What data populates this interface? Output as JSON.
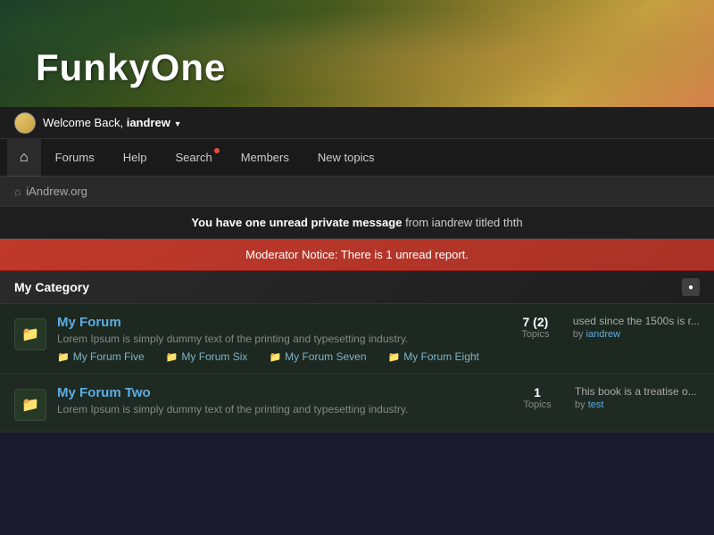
{
  "site": {
    "title": "FunkyOne"
  },
  "userbar": {
    "welcome_text": "Welcome Back,",
    "username": "iandrew",
    "dropdown_char": "▾"
  },
  "nav": {
    "home_icon": "⌂",
    "items": [
      {
        "label": "Forums",
        "id": "forums",
        "active": false
      },
      {
        "label": "Help",
        "id": "help",
        "active": false
      },
      {
        "label": "Search",
        "id": "search",
        "active": false,
        "has_dot": true
      },
      {
        "label": "Members",
        "id": "members",
        "active": false
      },
      {
        "label": "New topics",
        "id": "new-topics",
        "active": false
      }
    ]
  },
  "breadcrumb": {
    "icon": "⌂",
    "text": "iAndrew.org"
  },
  "notices": {
    "private_message": {
      "prefix": "You have one unread private message",
      "suffix": "from iandrew titled thth"
    },
    "moderator": "Moderator Notice: There is 1 unread report."
  },
  "category": {
    "title": "My Category",
    "toggle_icon": "●"
  },
  "forums": [
    {
      "id": "forum-1",
      "name": "My Forum",
      "description": "Lorem Ipsum is simply dummy text of the printing and typesetting industry.",
      "topics": "7 (2)",
      "topics_label": "Topics",
      "last_post_text": "used since the 1500s is r...",
      "last_post_by": "iandrew",
      "sub_forums": [
        {
          "label": "My Forum Five"
        },
        {
          "label": "My Forum Six"
        },
        {
          "label": "My Forum Seven"
        },
        {
          "label": "My Forum Eight"
        }
      ]
    },
    {
      "id": "forum-2",
      "name": "My Forum Two",
      "description": "Lorem Ipsum is simply dummy text of the printing and typesetting industry.",
      "topics": "1",
      "topics_label": "Topics",
      "last_post_text": "This book is a treatise o...",
      "last_post_by": "test",
      "sub_forums": []
    }
  ]
}
